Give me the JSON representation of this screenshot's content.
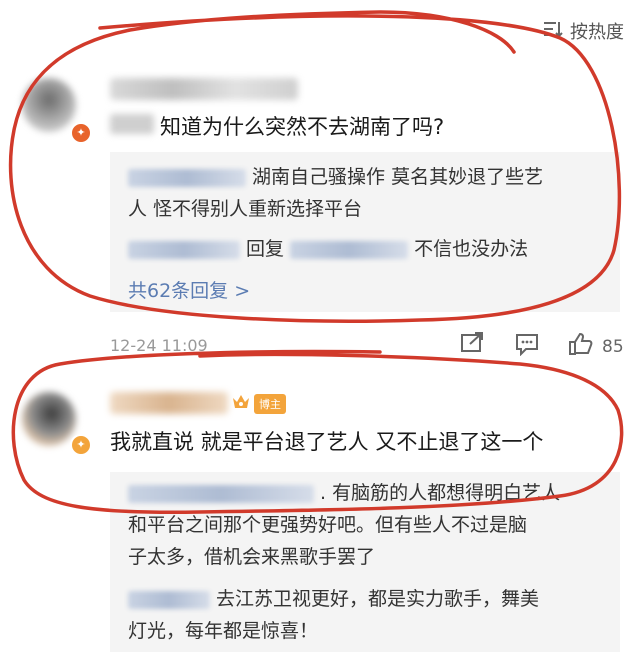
{
  "sort": {
    "label": "按热度"
  },
  "comment1": {
    "text": "知道为什么突然不去湖南了吗?",
    "replies": [
      {
        "text": "湖南自己骚操作 莫名其妙退了些艺"
      },
      {
        "text": "人 怪不得别人重新选择平台"
      },
      {
        "reply_label": "回复",
        "text": "不信也没办法"
      }
    ],
    "more_replies": "共62条回复 >",
    "time": "12-24 11:09",
    "like_count": "85"
  },
  "comment2": {
    "owner_tag": "博主",
    "text": "我就直说 就是平台退了艺人 又不止退了这一个",
    "replies": [
      {
        "text": ". 有脑筋的人都想得明白艺人"
      },
      {
        "text": "和平台之间那个更强势好吧。但有些人不过是脑"
      },
      {
        "text": "子太多，借机会来黑歌手罢了"
      },
      {
        "text": "去江苏卫视更好，都是实力歌手，舞美"
      },
      {
        "text": "灯光，每年都是惊喜！"
      }
    ]
  }
}
